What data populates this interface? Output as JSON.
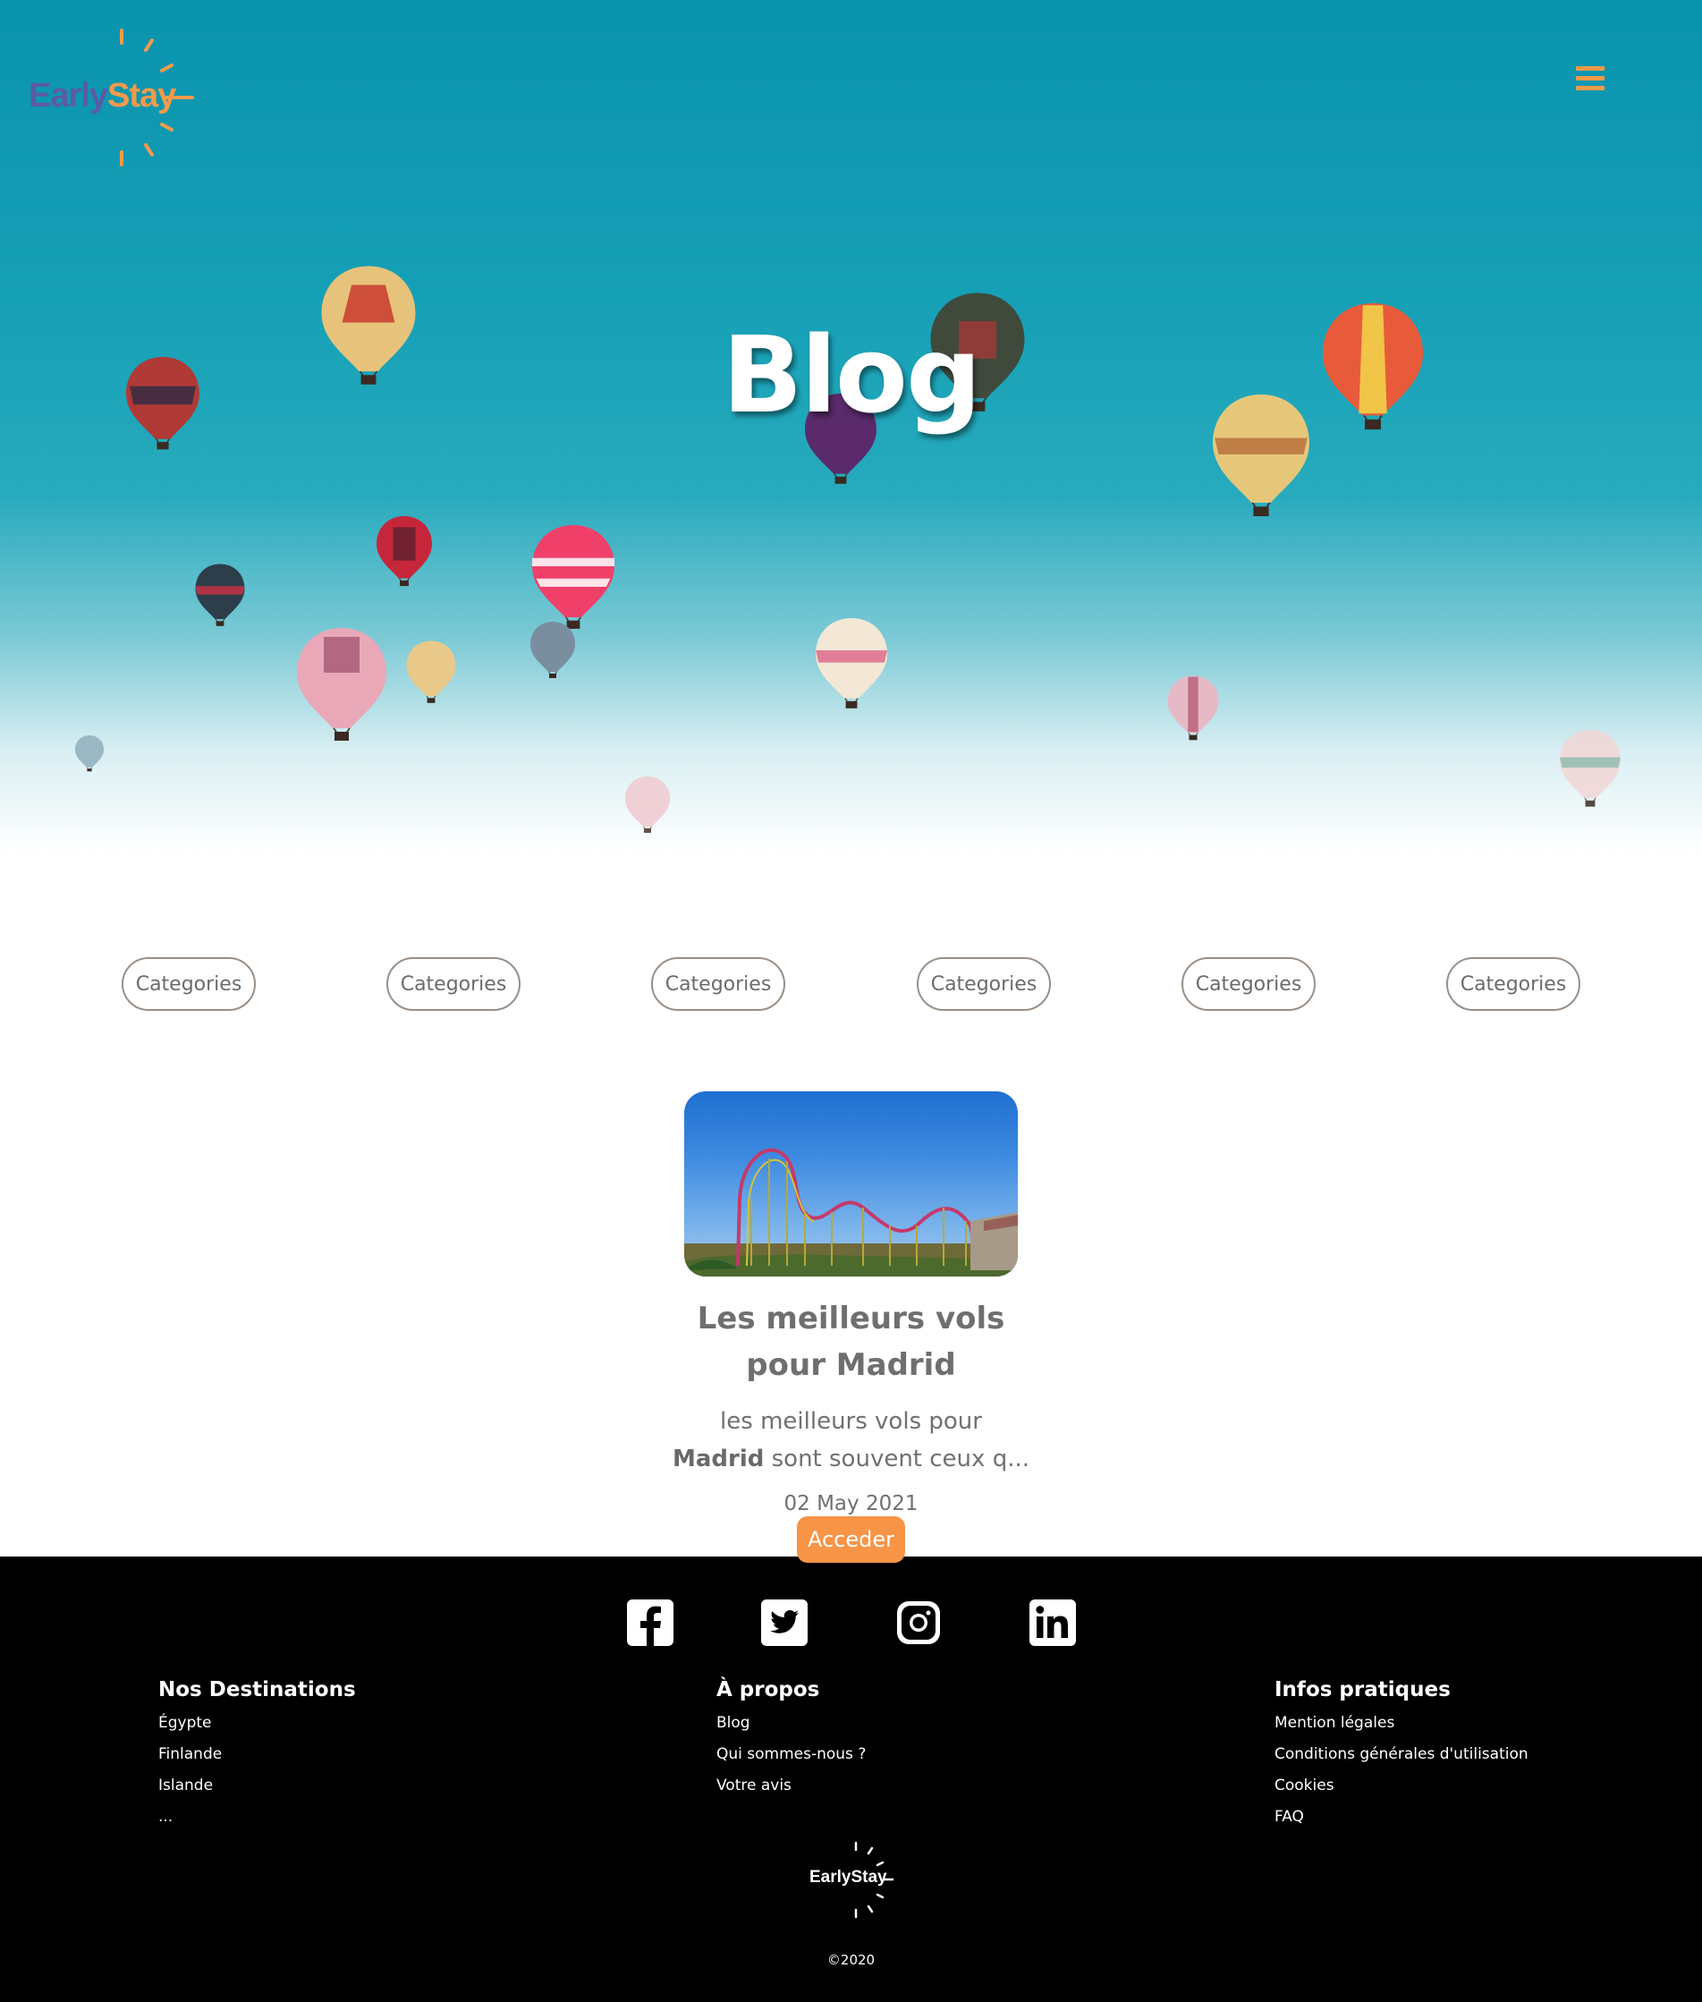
{
  "brand": {
    "early": "Early",
    "stay": "Stay",
    "colors": {
      "purple": "#5c5aa5",
      "orange": "#f39a4a"
    }
  },
  "header": {
    "menu_icon": "hamburger-menu-icon"
  },
  "hero": {
    "title": "Blog"
  },
  "categories": [
    "Categories",
    "Categories",
    "Categories",
    "Categories",
    "Categories",
    "Categories"
  ],
  "article": {
    "title_line1": "Les meilleurs vols",
    "title_line2": "pour Madrid",
    "excerpt_line1": "les meilleurs vols pour",
    "excerpt_bold": "Madrid",
    "excerpt_rest": " sont souvent ceux q...",
    "date": "02 May 2021",
    "button": "Acceder"
  },
  "footer": {
    "social": [
      "facebook-icon",
      "twitter-icon",
      "instagram-icon",
      "linkedin-icon"
    ],
    "columns": [
      {
        "title": "Nos Destinations",
        "items": [
          "Égypte",
          "Finlande",
          "Islande",
          "..."
        ]
      },
      {
        "title": "À propos",
        "items": [
          "Blog",
          "Qui sommes-nous ?",
          "Votre avis"
        ]
      },
      {
        "title": "Infos pratiques",
        "items": [
          "Mention légales",
          "Conditions générales d'utilisation",
          "Cookies",
          "FAQ"
        ]
      }
    ],
    "logo": "EarlyStay",
    "copyright": "©2020"
  },
  "colors": {
    "accent": "#f79446",
    "hero_sky": "#0a93ad",
    "footer_bg": "#000000"
  }
}
